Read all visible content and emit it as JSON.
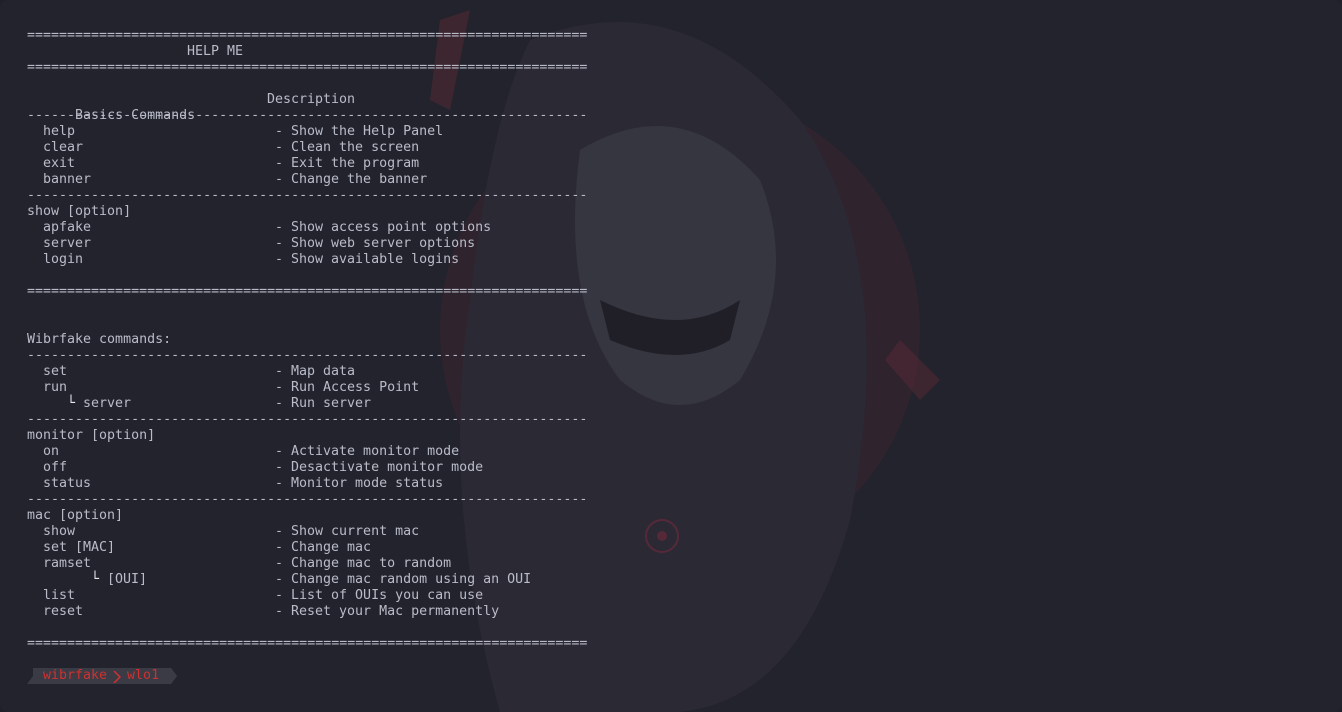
{
  "help": {
    "rule_double": "======================================================================",
    "rule_single": "----------------------------------------------------------------------",
    "title": "HELP ME",
    "columns": {
      "commands": "Basics Commands",
      "description": "Description"
    },
    "basics": [
      {
        "cmd": "help",
        "desc": "- Show the Help Panel"
      },
      {
        "cmd": "clear",
        "desc": "- Clean the screen"
      },
      {
        "cmd": "exit",
        "desc": "- Exit the program"
      },
      {
        "cmd": "banner",
        "desc": "- Change the banner"
      }
    ],
    "show_header": "show [option]",
    "show": [
      {
        "cmd": "apfake",
        "desc": "- Show access point options"
      },
      {
        "cmd": "server",
        "desc": "- Show web server options"
      },
      {
        "cmd": "login",
        "desc": "- Show available logins"
      }
    ],
    "wibrfake_header": "Wibrfake commands:",
    "wibrfake": [
      {
        "cmd": "set",
        "desc": "- Map data"
      },
      {
        "cmd": "run",
        "desc": "- Run Access Point"
      },
      {
        "cmd": "server",
        "branch": "└",
        "desc": "- Run server"
      }
    ],
    "monitor_header": "monitor [option]",
    "monitor": [
      {
        "cmd": "on",
        "desc": "- Activate monitor mode"
      },
      {
        "cmd": "off",
        "desc": "- Desactivate monitor mode"
      },
      {
        "cmd": "status",
        "desc": "- Monitor mode status"
      }
    ],
    "mac_header": "mac [option]",
    "mac": [
      {
        "cmd": "show",
        "desc": "- Show current mac"
      },
      {
        "cmd": "set [MAC]",
        "desc": "- Change mac"
      },
      {
        "cmd": "ramset",
        "desc": "- Change mac to random"
      },
      {
        "cmd": "[OUI]",
        "branch": "└",
        "desc": "- Change mac random using an OUI"
      },
      {
        "cmd": "list",
        "desc": "- List of OUIs you can use"
      },
      {
        "cmd": "reset",
        "desc": "- Reset your Mac permanently"
      }
    ]
  },
  "prompt": {
    "app": "wibrfake",
    "interface": "wlo1",
    "accent_color": "#d23030",
    "separator_icon": "chevron-right-icon"
  },
  "colors": {
    "background": "#22232d",
    "text": "#b9bcc8"
  }
}
